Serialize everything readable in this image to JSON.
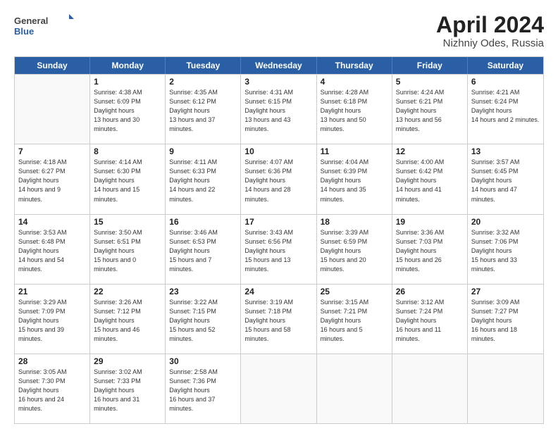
{
  "header": {
    "title": "April 2024",
    "subtitle": "Nizhniy Odes, Russia",
    "logo_line1": "General",
    "logo_line2": "Blue"
  },
  "days_of_week": [
    "Sunday",
    "Monday",
    "Tuesday",
    "Wednesday",
    "Thursday",
    "Friday",
    "Saturday"
  ],
  "weeks": [
    [
      {
        "day": "",
        "empty": true
      },
      {
        "day": "1",
        "sunrise": "4:38 AM",
        "sunset": "6:09 PM",
        "daylight": "13 hours and 30 minutes."
      },
      {
        "day": "2",
        "sunrise": "4:35 AM",
        "sunset": "6:12 PM",
        "daylight": "13 hours and 37 minutes."
      },
      {
        "day": "3",
        "sunrise": "4:31 AM",
        "sunset": "6:15 PM",
        "daylight": "13 hours and 43 minutes."
      },
      {
        "day": "4",
        "sunrise": "4:28 AM",
        "sunset": "6:18 PM",
        "daylight": "13 hours and 50 minutes."
      },
      {
        "day": "5",
        "sunrise": "4:24 AM",
        "sunset": "6:21 PM",
        "daylight": "13 hours and 56 minutes."
      },
      {
        "day": "6",
        "sunrise": "4:21 AM",
        "sunset": "6:24 PM",
        "daylight": "14 hours and 2 minutes."
      }
    ],
    [
      {
        "day": "7",
        "sunrise": "4:18 AM",
        "sunset": "6:27 PM",
        "daylight": "14 hours and 9 minutes."
      },
      {
        "day": "8",
        "sunrise": "4:14 AM",
        "sunset": "6:30 PM",
        "daylight": "14 hours and 15 minutes."
      },
      {
        "day": "9",
        "sunrise": "4:11 AM",
        "sunset": "6:33 PM",
        "daylight": "14 hours and 22 minutes."
      },
      {
        "day": "10",
        "sunrise": "4:07 AM",
        "sunset": "6:36 PM",
        "daylight": "14 hours and 28 minutes."
      },
      {
        "day": "11",
        "sunrise": "4:04 AM",
        "sunset": "6:39 PM",
        "daylight": "14 hours and 35 minutes."
      },
      {
        "day": "12",
        "sunrise": "4:00 AM",
        "sunset": "6:42 PM",
        "daylight": "14 hours and 41 minutes."
      },
      {
        "day": "13",
        "sunrise": "3:57 AM",
        "sunset": "6:45 PM",
        "daylight": "14 hours and 47 minutes."
      }
    ],
    [
      {
        "day": "14",
        "sunrise": "3:53 AM",
        "sunset": "6:48 PM",
        "daylight": "14 hours and 54 minutes."
      },
      {
        "day": "15",
        "sunrise": "3:50 AM",
        "sunset": "6:51 PM",
        "daylight": "15 hours and 0 minutes."
      },
      {
        "day": "16",
        "sunrise": "3:46 AM",
        "sunset": "6:53 PM",
        "daylight": "15 hours and 7 minutes."
      },
      {
        "day": "17",
        "sunrise": "3:43 AM",
        "sunset": "6:56 PM",
        "daylight": "15 hours and 13 minutes."
      },
      {
        "day": "18",
        "sunrise": "3:39 AM",
        "sunset": "6:59 PM",
        "daylight": "15 hours and 20 minutes."
      },
      {
        "day": "19",
        "sunrise": "3:36 AM",
        "sunset": "7:03 PM",
        "daylight": "15 hours and 26 minutes."
      },
      {
        "day": "20",
        "sunrise": "3:32 AM",
        "sunset": "7:06 PM",
        "daylight": "15 hours and 33 minutes."
      }
    ],
    [
      {
        "day": "21",
        "sunrise": "3:29 AM",
        "sunset": "7:09 PM",
        "daylight": "15 hours and 39 minutes."
      },
      {
        "day": "22",
        "sunrise": "3:26 AM",
        "sunset": "7:12 PM",
        "daylight": "15 hours and 46 minutes."
      },
      {
        "day": "23",
        "sunrise": "3:22 AM",
        "sunset": "7:15 PM",
        "daylight": "15 hours and 52 minutes."
      },
      {
        "day": "24",
        "sunrise": "3:19 AM",
        "sunset": "7:18 PM",
        "daylight": "15 hours and 58 minutes."
      },
      {
        "day": "25",
        "sunrise": "3:15 AM",
        "sunset": "7:21 PM",
        "daylight": "16 hours and 5 minutes."
      },
      {
        "day": "26",
        "sunrise": "3:12 AM",
        "sunset": "7:24 PM",
        "daylight": "16 hours and 11 minutes."
      },
      {
        "day": "27",
        "sunrise": "3:09 AM",
        "sunset": "7:27 PM",
        "daylight": "16 hours and 18 minutes."
      }
    ],
    [
      {
        "day": "28",
        "sunrise": "3:05 AM",
        "sunset": "7:30 PM",
        "daylight": "16 hours and 24 minutes."
      },
      {
        "day": "29",
        "sunrise": "3:02 AM",
        "sunset": "7:33 PM",
        "daylight": "16 hours and 31 minutes."
      },
      {
        "day": "30",
        "sunrise": "2:58 AM",
        "sunset": "7:36 PM",
        "daylight": "16 hours and 37 minutes."
      },
      {
        "day": "",
        "empty": true
      },
      {
        "day": "",
        "empty": true
      },
      {
        "day": "",
        "empty": true
      },
      {
        "day": "",
        "empty": true
      }
    ]
  ]
}
